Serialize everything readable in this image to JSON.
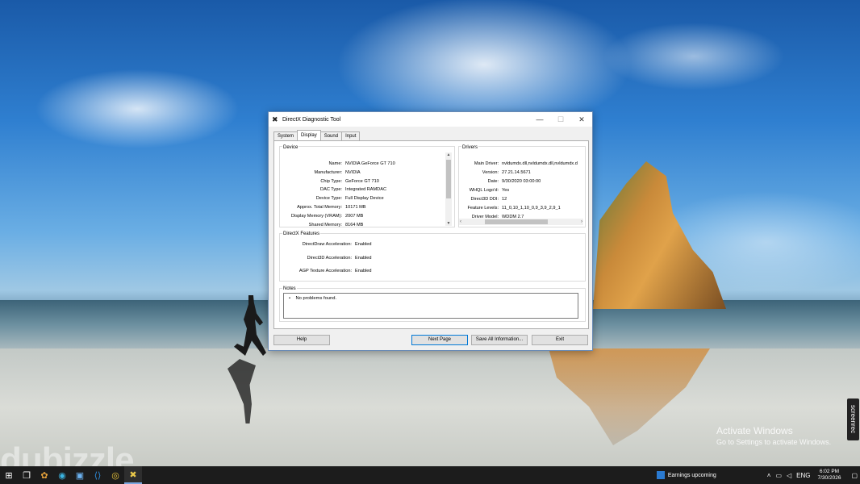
{
  "desktop": {
    "watermark": "dubizzle",
    "activate_title": "Activate Windows",
    "activate_sub": "Go to Settings to activate Windows.",
    "screenrec": "screenrec"
  },
  "dialog": {
    "title": "DirectX Diagnostic Tool",
    "tabs": [
      "System",
      "Display",
      "Sound",
      "Input"
    ],
    "active_tab": "Display",
    "device": {
      "title": "Device",
      "rows": [
        {
          "k": "Name:",
          "v": "NVIDIA GeForce GT 710"
        },
        {
          "k": "Manufacturer:",
          "v": "NVIDIA"
        },
        {
          "k": "Chip Type:",
          "v": "GeForce GT 710"
        },
        {
          "k": "DAC Type:",
          "v": "Integrated RAMDAC"
        },
        {
          "k": "Device Type:",
          "v": "Full Display Device"
        },
        {
          "k": "Approx. Total Memory:",
          "v": "10171 MB"
        },
        {
          "k": "Display Memory (VRAM):",
          "v": "2007 MB"
        },
        {
          "k": "Shared Memory:",
          "v": "8164 MB"
        }
      ]
    },
    "drivers": {
      "title": "Drivers",
      "rows": [
        {
          "k": "Main Driver:",
          "v": "nvldumdx.dll,nvldumdx.dll,nvldumdx.d"
        },
        {
          "k": "Version:",
          "v": "27.21.14.5671"
        },
        {
          "k": "Date:",
          "v": "9/30/2020 03:00:00"
        },
        {
          "k": "WHQL Logo'd:",
          "v": "Yes"
        },
        {
          "k": "Direct3D DDI:",
          "v": "12"
        },
        {
          "k": "Feature Levels:",
          "v": "11_0,10_1,10_0,9_3,9_2,9_1"
        },
        {
          "k": "Driver Model:",
          "v": "WDDM 2.7"
        }
      ]
    },
    "features": {
      "title": "DirectX Features",
      "rows": [
        {
          "k": "DirectDraw Acceleration:",
          "v": "Enabled"
        },
        {
          "k": "Direct3D Acceleration:",
          "v": "Enabled"
        },
        {
          "k": "AGP Texture Acceleration:",
          "v": "Enabled"
        }
      ]
    },
    "notes": {
      "title": "Notes",
      "items": [
        "No problems found."
      ]
    },
    "buttons": {
      "help": "Help",
      "next": "Next Page",
      "save": "Save All Information...",
      "exit": "Exit"
    }
  },
  "taskbar": {
    "news": "Earnings upcoming",
    "lang": "ENG",
    "time": "6:02 PM",
    "date": "7/30/2026"
  }
}
